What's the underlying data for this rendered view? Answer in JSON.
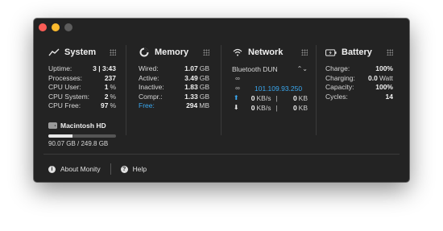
{
  "system": {
    "title": "System",
    "rows": [
      {
        "label": "Uptime:",
        "value": "3 | 3:43",
        "unit": ""
      },
      {
        "label": "Processes:",
        "value": "237",
        "unit": ""
      },
      {
        "label": "CPU User:",
        "value": "1",
        "unit": "%"
      },
      {
        "label": "CPU System:",
        "value": "2",
        "unit": "%"
      },
      {
        "label": "CPU Free:",
        "value": "97",
        "unit": "%"
      }
    ]
  },
  "memory": {
    "title": "Memory",
    "rows": [
      {
        "label": "Wired:",
        "value": "1.07",
        "unit": "GB"
      },
      {
        "label": "Active:",
        "value": "3.49",
        "unit": "GB"
      },
      {
        "label": "Inactive:",
        "value": "1.83",
        "unit": "GB"
      },
      {
        "label": "Compr.:",
        "value": "1.33",
        "unit": "GB"
      },
      {
        "label": "Free:",
        "value": "294",
        "unit": "MB"
      }
    ]
  },
  "network": {
    "title": "Network",
    "interface": "Bluetooth DUN",
    "ip": "101.109.93.250",
    "upload": {
      "rate": "0",
      "rate_unit": "KB/s",
      "total": "0",
      "total_unit": "KB"
    },
    "download": {
      "rate": "0",
      "rate_unit": "KB/s",
      "total": "0",
      "total_unit": "KB"
    }
  },
  "battery": {
    "title": "Battery",
    "rows": [
      {
        "label": "Charge:",
        "value": "100%",
        "unit": ""
      },
      {
        "label": "Charging:",
        "value": "0.0",
        "unit": "Watt"
      },
      {
        "label": "Capacity:",
        "value": "100%",
        "unit": ""
      },
      {
        "label": "Cycles:",
        "value": "14",
        "unit": ""
      }
    ]
  },
  "disk": {
    "name": "Macintosh HD",
    "usage": "90.07 GB / 249.8 GB",
    "used_fraction": 0.36
  },
  "footer": {
    "about_label": "About Monity",
    "help_label": "Help"
  },
  "colors": {
    "accent": "#3aa8f0",
    "background": "#232323"
  }
}
